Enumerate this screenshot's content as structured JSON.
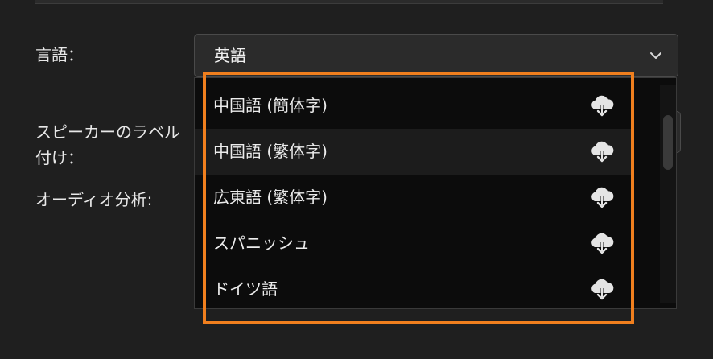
{
  "form": {
    "language_label": "言語：",
    "speaker_label_line1": "スピーカーのラベル",
    "speaker_label_line2": "付け：",
    "audio_label": "オーディオ分析:",
    "language_value": "英語"
  },
  "dropdown": {
    "options": [
      {
        "label": "中国語 (簡体字)",
        "icon": "cloud-download-icon"
      },
      {
        "label": "中国語 (繁体字)",
        "icon": "cloud-download-icon"
      },
      {
        "label": "広東語 (繁体字)",
        "icon": "cloud-download-icon"
      },
      {
        "label": "スパニッシュ",
        "icon": "cloud-download-icon"
      },
      {
        "label": "ドイツ語",
        "icon": "cloud-download-icon"
      }
    ],
    "hovered_index": 1
  },
  "colors": {
    "highlight": "#f07f1e",
    "background": "#1f1f1f",
    "dropdown_bg": "#0c0c0c"
  }
}
